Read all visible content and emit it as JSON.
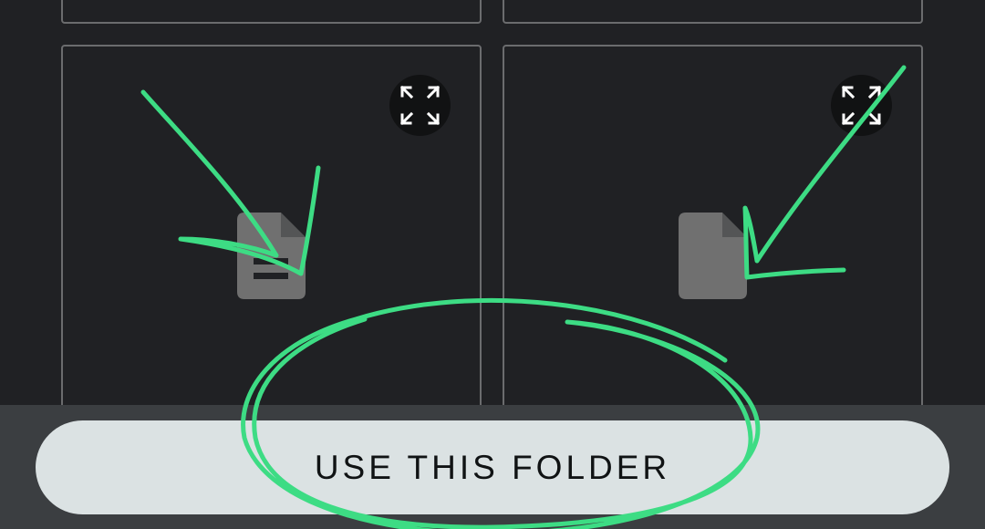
{
  "tiles": [
    {
      "name": "file-tile-left",
      "icon": "document-text-icon",
      "expand_icon": "fullscreen-icon"
    },
    {
      "name": "file-tile-right",
      "icon": "document-icon",
      "expand_icon": "fullscreen-icon"
    }
  ],
  "bottom_bar": {
    "use_folder_label": "USE THIS FOLDER"
  },
  "colors": {
    "background": "#202124",
    "tile_border": "#6b6c6e",
    "file_icon": "#707070",
    "bottom_bar": "#3b3e41",
    "button_fill": "#dbe2e3",
    "annotation_stroke": "#3ddc84"
  }
}
